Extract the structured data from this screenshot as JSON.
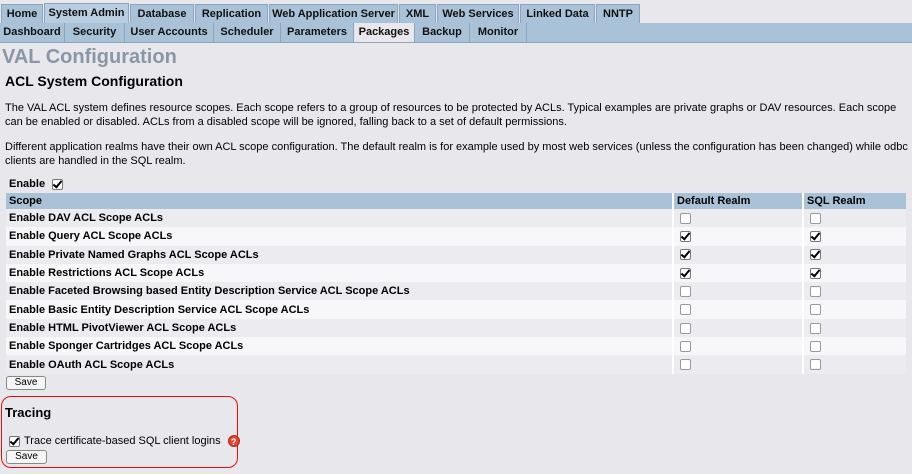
{
  "nav": {
    "main_tabs": [
      "Home",
      "System Admin",
      "Database",
      "Replication",
      "Web Application Server",
      "XML",
      "Web Services",
      "Linked Data",
      "NNTP"
    ],
    "active_main_tab": "System Admin",
    "sub_tabs": [
      "Dashboard",
      "Security",
      "User Accounts",
      "Scheduler",
      "Parameters",
      "Packages",
      "Backup",
      "Monitor"
    ],
    "active_sub_tab": "Packages"
  },
  "page": {
    "title": "VAL Configuration",
    "section_title": "ACL System Configuration",
    "paragraph1": "The VAL ACL system defines resource scopes. Each scope refers to a group of resources to be protected by ACLs. Typical examples are private graphs or DAV resources. Each scope can be enabled or disabled. ACLs from a disabled scope will be ignored, falling back to a set of default permissions.",
    "paragraph2": "Different application realms have their own ACL scope configuration. The default realm is for example used by most web services (unless the configuration has been changed) while odbc clients are handled in the SQL realm."
  },
  "enable": {
    "label": "Enable",
    "checked": true
  },
  "table": {
    "headers": {
      "scope": "Scope",
      "default_realm": "Default Realm",
      "sql_realm": "SQL Realm"
    },
    "rows": [
      {
        "label": "Enable DAV ACL Scope ACLs",
        "default": false,
        "sql": false
      },
      {
        "label": "Enable Query ACL Scope ACLs",
        "default": true,
        "sql": true
      },
      {
        "label": "Enable Private Named Graphs ACL Scope ACLs",
        "default": true,
        "sql": true
      },
      {
        "label": "Enable Restrictions ACL Scope ACLs",
        "default": true,
        "sql": true
      },
      {
        "label": "Enable Faceted Browsing based Entity Description Service ACL Scope ACLs",
        "default": false,
        "sql": false
      },
      {
        "label": "Enable Basic Entity Description Service ACL Scope ACLs",
        "default": false,
        "sql": false
      },
      {
        "label": "Enable HTML PivotViewer ACL Scope ACLs",
        "default": false,
        "sql": false
      },
      {
        "label": "Enable Sponger Cartridges ACL Scope ACLs",
        "default": false,
        "sql": false
      },
      {
        "label": "Enable OAuth ACL Scope ACLs",
        "default": false,
        "sql": false
      }
    ]
  },
  "save_label": "Save",
  "tracing": {
    "title": "Tracing",
    "trace_label": "Trace certificate-based SQL client logins",
    "trace_checked": true,
    "help_glyph": "?",
    "save_label": "Save"
  },
  "colors": {
    "tab_bg": "#a9c2d8",
    "page_bg": "#e8e8ec",
    "title_color": "#8a96a8",
    "tracing_border": "#e01010",
    "help_icon": "#e8432e"
  }
}
